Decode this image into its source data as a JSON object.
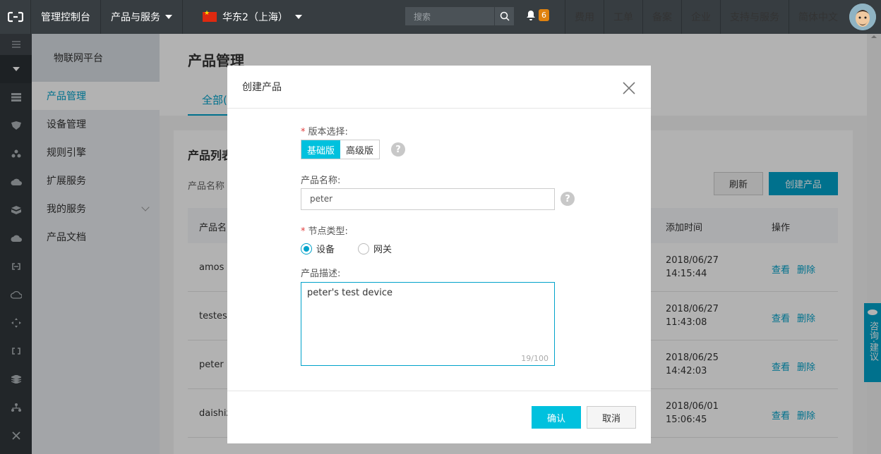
{
  "topbar": {
    "console": "管理控制台",
    "products_menu": "产品与服务",
    "region": "华东2（上海）",
    "search_placeholder": "搜索",
    "notification_count": "6",
    "right_nav": [
      "费用",
      "工单",
      "备案",
      "企业",
      "支持与服务",
      "简体中文"
    ]
  },
  "sidebar": {
    "header": "物联网平台",
    "items": [
      "产品管理",
      "设备管理",
      "规则引擎",
      "扩展服务",
      "我的服务",
      "产品文档"
    ]
  },
  "main": {
    "title": "产品管理",
    "tab": "全部(",
    "card_title": "产品列表",
    "filter_label": "产品名称",
    "refresh": "刷新",
    "create": "创建产品",
    "columns": [
      "产品名",
      "添加时间",
      "操作"
    ],
    "rows": [
      {
        "name": "amos",
        "date": "2018/06/27",
        "time": "14:15:44"
      },
      {
        "name": "testest",
        "date": "2018/06/27",
        "time": "11:43:08"
      },
      {
        "name": "peter",
        "date": "2018/06/25",
        "time": "14:42:03"
      },
      {
        "name": "daishiz",
        "date": "2018/06/01",
        "time": "15:06:45"
      }
    ],
    "view": "查看",
    "delete": "删除"
  },
  "float_widget": "咨询·建议",
  "modal": {
    "title": "创建产品",
    "version_label": "版本选择:",
    "version_basic": "基础版",
    "version_advanced": "高级版",
    "name_label": "产品名称:",
    "name_value": "peter",
    "node_label": "节点类型:",
    "node_device": "设备",
    "node_gateway": "网关",
    "desc_label": "产品描述:",
    "desc_value": "peter's test device",
    "desc_counter": "19/100",
    "ok": "确认",
    "cancel": "取消"
  },
  "colors": {
    "accent": "#00a2ca",
    "accent_light": "#00c1de",
    "topbar": "#373d41",
    "required": "#e03d3d"
  }
}
